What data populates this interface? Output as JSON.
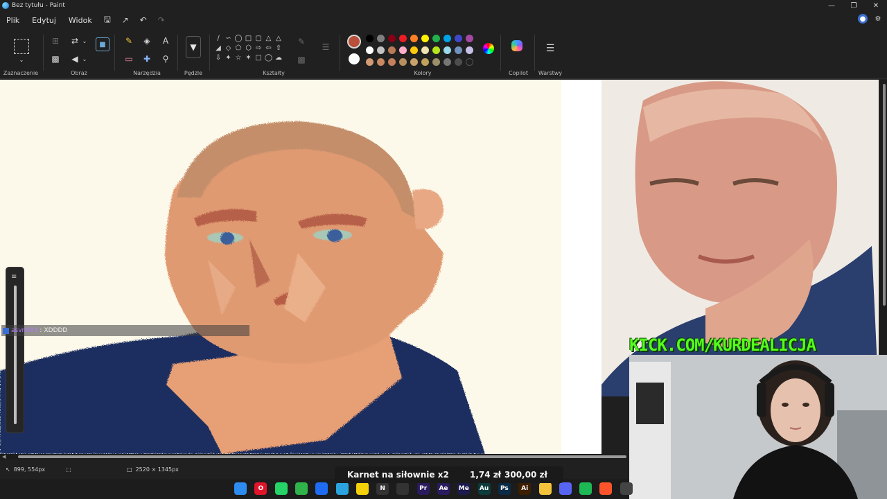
{
  "window": {
    "title": "Bez tytułu - Paint",
    "controls": [
      "minimize-icon",
      "maximize-icon",
      "close-icon"
    ]
  },
  "menu": {
    "items": [
      "Plik",
      "Edytuj",
      "Widok"
    ],
    "icons": [
      "save-icon",
      "share-icon",
      "undo-icon",
      "redo-icon"
    ]
  },
  "ribbon": {
    "groups": {
      "selection": "Zaznaczenie",
      "image": "Obraz",
      "tools": "Narzędzia",
      "brushes": "Pędzle",
      "shapes": "Kształty",
      "colors": "Kolory",
      "copilot": "Copilot",
      "layers": "Warstwy"
    },
    "text_tool_glyph": "A",
    "current_color": "#b8503a",
    "secondary_color": "#ffffff",
    "palette": [
      "#000000",
      "#7f7f7f",
      "#880015",
      "#ed1c24",
      "#ff7f27",
      "#fff200",
      "#22b14c",
      "#00a2e8",
      "#3f48cc",
      "#a349a4",
      "#ffffff",
      "#c3c3c3",
      "#b97a57",
      "#ffaec9",
      "#ffc90e",
      "#efe4b0",
      "#b5e61d",
      "#99d9ea",
      "#7092be",
      "#c8bfe7",
      "#d29b74",
      "#c98a61",
      "#c2805c",
      "#b8905f",
      "#c9a26b",
      "#bfa25a",
      "#9c8f6a",
      "#767676",
      "#4d4d4d",
      "empty"
    ]
  },
  "chat": {
    "user": "asvn003",
    "separator": ":",
    "message": "XDDDD"
  },
  "stream": {
    "banner": "KICK.COM/KURDEALICJA",
    "goal_name": "Karnet na siłownie x2",
    "goal_current": "1,74 zł",
    "goal_separator": "z",
    "goal_target": "300,00 zł"
  },
  "status": {
    "cursor_position": "899, 554px",
    "canvas_size": "2520 × 1345px"
  },
  "taskbar": {
    "apps": [
      {
        "name": "windows-start",
        "label": "",
        "color": "#2d8cf0"
      },
      {
        "name": "opera",
        "label": "O",
        "color": "#e0142b"
      },
      {
        "name": "whatsapp",
        "label": "",
        "color": "#25d366"
      },
      {
        "name": "chrome-green",
        "label": "",
        "color": "#2fb34a"
      },
      {
        "name": "messenger",
        "label": "",
        "color": "#1e6cf2"
      },
      {
        "name": "telegram",
        "label": "",
        "color": "#2aa3df"
      },
      {
        "name": "miro",
        "label": "",
        "color": "#f5d10a"
      },
      {
        "name": "notion",
        "label": "N",
        "color": "#333333"
      },
      {
        "name": "capcut",
        "label": "",
        "color": "#333333"
      },
      {
        "name": "premiere",
        "label": "Pr",
        "color": "#2a1a5e"
      },
      {
        "name": "after-effects",
        "label": "Ae",
        "color": "#2a1a5e"
      },
      {
        "name": "media-encoder",
        "label": "Me",
        "color": "#1d1a4e"
      },
      {
        "name": "audition",
        "label": "Au",
        "color": "#0d3a3a"
      },
      {
        "name": "photoshop",
        "label": "Ps",
        "color": "#0b2a45"
      },
      {
        "name": "illustrator",
        "label": "Ai",
        "color": "#3d1f00"
      },
      {
        "name": "file-explorer",
        "label": "",
        "color": "#f2c33b"
      },
      {
        "name": "discord",
        "label": "",
        "color": "#5865f2"
      },
      {
        "name": "spotify",
        "label": "",
        "color": "#1db954"
      },
      {
        "name": "brave",
        "label": "",
        "color": "#fb542b"
      },
      {
        "name": "obs",
        "label": "",
        "color": "#444444"
      }
    ]
  }
}
